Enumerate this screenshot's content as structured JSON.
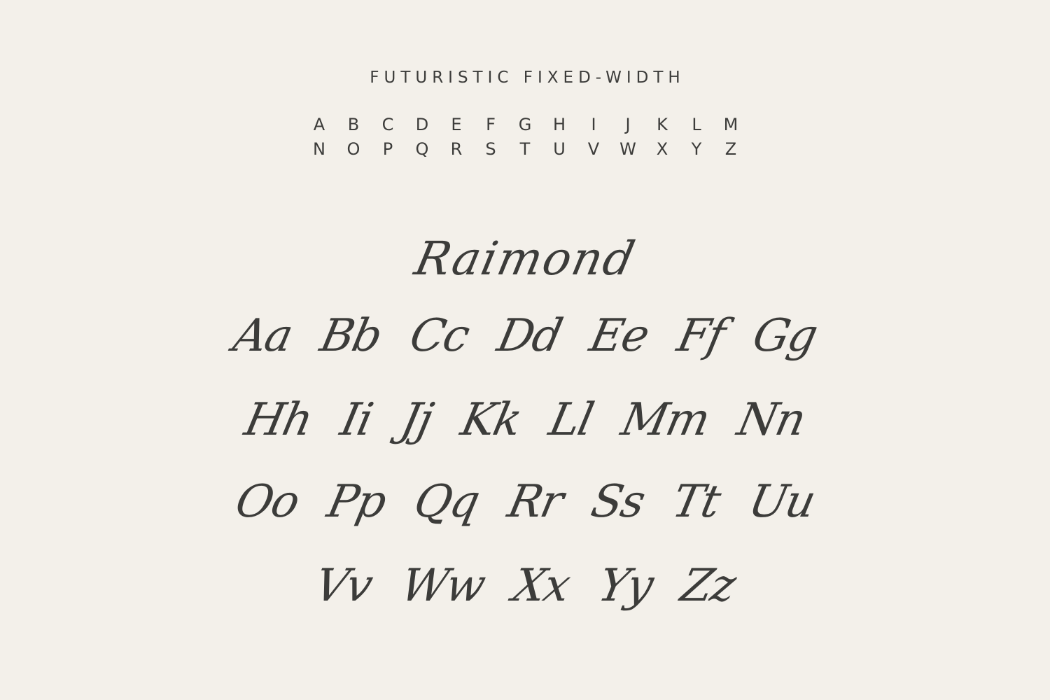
{
  "heading": "FUTURISTIC FIXED-WIDTH",
  "alphabet_row1": [
    "A",
    "B",
    "C",
    "D",
    "E",
    "F",
    "G",
    "H",
    "I",
    "J",
    "K",
    "L",
    "M"
  ],
  "alphabet_row2": [
    "N",
    "O",
    "P",
    "Q",
    "R",
    "S",
    "T",
    "U",
    "V",
    "W",
    "X",
    "Y",
    "Z"
  ],
  "script_title": "Raimond",
  "script_pairs_row1": [
    "Aa",
    "Bb",
    "Cc",
    "Dd",
    "Ee",
    "Ff",
    "Gg"
  ],
  "script_pairs_row2": [
    "Hh",
    "Ii",
    "Jj",
    "Kk",
    "Ll",
    "Mm",
    "Nn"
  ],
  "script_pairs_row3": [
    "Oo",
    "Pp",
    "Qq",
    "Rr",
    "Ss",
    "Tt",
    "Uu"
  ],
  "script_pairs_row4": [
    "Vv",
    "Ww",
    "Xx",
    "Yy",
    "Zz"
  ],
  "colors": {
    "background": "#f3f0ea",
    "ink": "#3c3c3a"
  }
}
